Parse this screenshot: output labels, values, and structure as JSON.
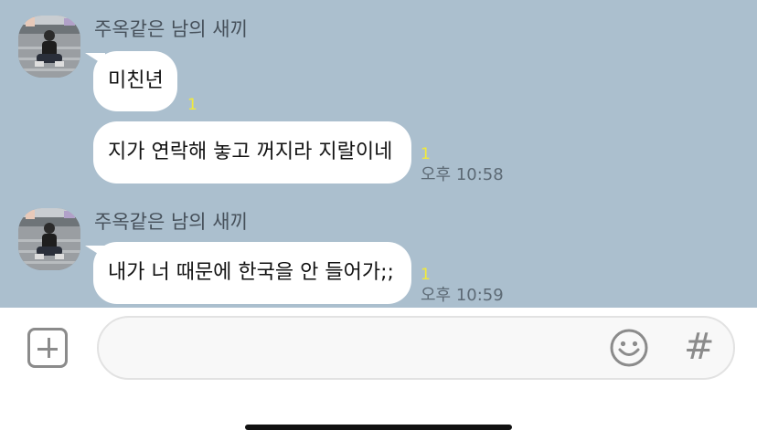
{
  "colors": {
    "chat_background": "#abbfce",
    "bubble": "#ffffff",
    "unread_count": "#f2ea3a",
    "time_text": "#5d6a75"
  },
  "messages": [
    {
      "sender": "주옥같은 남의 새끼",
      "bubbles": [
        {
          "text": "미친년",
          "unread": "1",
          "time": ""
        },
        {
          "text": "지가 연락해 놓고 꺼지라 지랄이네",
          "unread": "1",
          "time": "오후 10:58"
        }
      ]
    },
    {
      "sender": "주옥같은 남의 새끼",
      "bubbles": [
        {
          "text": "내가 너 때문에 한국을 안 들어가;;",
          "unread": "1",
          "time": "오후 10:59"
        }
      ]
    }
  ],
  "composer": {
    "attach_icon": "plus-square-icon",
    "emoji_icon": "smiley-icon",
    "hash_label": "#",
    "input_value": ""
  }
}
